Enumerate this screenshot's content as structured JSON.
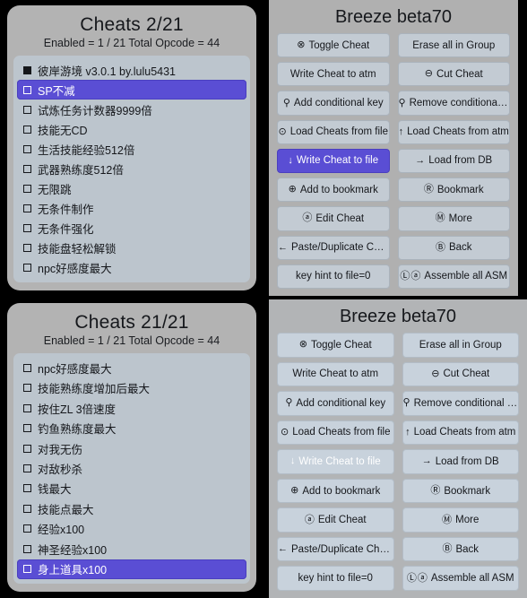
{
  "panels": {
    "cheats_top": {
      "title": "Cheats 2/21",
      "subtitle": "Enabled = 1 / 21  Total Opcode = 44",
      "rows": [
        {
          "label": "彼岸游境 v3.0.1 by.lulu5431",
          "kind": "group",
          "selected": false
        },
        {
          "label": "SP不减",
          "kind": "cheat",
          "selected": true
        },
        {
          "label": "试炼任务计数器9999倍",
          "kind": "cheat",
          "selected": false
        },
        {
          "label": "技能无CD",
          "kind": "cheat",
          "selected": false
        },
        {
          "label": "生活技能经验512倍",
          "kind": "cheat",
          "selected": false
        },
        {
          "label": "武器熟练度512倍",
          "kind": "cheat",
          "selected": false
        },
        {
          "label": "无限跳",
          "kind": "cheat",
          "selected": false
        },
        {
          "label": "无条件制作",
          "kind": "cheat",
          "selected": false
        },
        {
          "label": "无条件强化",
          "kind": "cheat",
          "selected": false
        },
        {
          "label": "技能盘轻松解锁",
          "kind": "cheat",
          "selected": false
        },
        {
          "label": "npc好感度最大",
          "kind": "cheat",
          "selected": false
        }
      ]
    },
    "cheats_bottom": {
      "title": "Cheats 21/21",
      "subtitle": "Enabled = 1 / 21  Total Opcode = 44",
      "rows": [
        {
          "label": "npc好感度最大",
          "kind": "cheat",
          "selected": false
        },
        {
          "label": "技能熟练度增加后最大",
          "kind": "cheat",
          "selected": false
        },
        {
          "label": "按住ZL 3倍速度",
          "kind": "cheat",
          "selected": false
        },
        {
          "label": "钓鱼熟练度最大",
          "kind": "cheat",
          "selected": false
        },
        {
          "label": "对我无伤",
          "kind": "cheat",
          "selected": false
        },
        {
          "label": "对敌秒杀",
          "kind": "cheat",
          "selected": false
        },
        {
          "label": "钱最大",
          "kind": "cheat",
          "selected": false
        },
        {
          "label": "技能点最大",
          "kind": "cheat",
          "selected": false
        },
        {
          "label": "经验x100",
          "kind": "cheat",
          "selected": false
        },
        {
          "label": "神圣经验x100",
          "kind": "cheat",
          "selected": false
        },
        {
          "label": "身上道具x100",
          "kind": "cheat",
          "selected": true
        }
      ]
    },
    "breeze_top": {
      "title": "Breeze beta70",
      "buttons": [
        {
          "label": "Toggle Cheat",
          "icon": "⊗",
          "icon_name": "circle-x-icon",
          "primary": false
        },
        {
          "label": "Erase all in Group",
          "icon": "",
          "icon_name": "",
          "primary": false
        },
        {
          "label": "Write Cheat to atm",
          "icon": "",
          "icon_name": "",
          "primary": false
        },
        {
          "label": "Cut Cheat",
          "icon": "⊖",
          "icon_name": "circle-minus-icon",
          "primary": false
        },
        {
          "label": "Add conditional key",
          "icon": "⚲",
          "icon_name": "key-icon",
          "primary": false
        },
        {
          "label": "Remove conditional key",
          "icon": "⚲",
          "icon_name": "key-icon",
          "primary": false
        },
        {
          "label": "Load Cheats from file",
          "icon": "⊙",
          "icon_name": "circle-dot-icon",
          "primary": false
        },
        {
          "label": "Load Cheats from atm",
          "icon": "↑",
          "icon_name": "arrow-up-icon",
          "primary": false
        },
        {
          "label": "Write Cheat to file",
          "icon": "↓",
          "icon_name": "arrow-down-icon",
          "primary": true
        },
        {
          "label": "Load from DB",
          "icon": "→",
          "icon_name": "arrow-right-icon",
          "primary": false
        },
        {
          "label": "Add to bookmark",
          "icon": "⊕",
          "icon_name": "circle-plus-icon",
          "primary": false
        },
        {
          "label": "Bookmark",
          "icon": "Ⓡ",
          "icon_name": "letter-r-icon",
          "primary": false
        },
        {
          "label": "Edit Cheat",
          "icon": "ⓐ",
          "icon_name": "letter-a-icon",
          "primary": false
        },
        {
          "label": "More",
          "icon": "Ⓜ",
          "icon_name": "letter-m-icon",
          "primary": false
        },
        {
          "label": "Paste/Duplicate Cheat",
          "icon": "←",
          "icon_name": "arrow-left-icon",
          "primary": false
        },
        {
          "label": "Back",
          "icon": "Ⓑ",
          "icon_name": "letter-b-icon",
          "primary": false
        },
        {
          "label": "key hint to file=0",
          "icon": "",
          "icon_name": "",
          "primary": false
        },
        {
          "label": "Assemble all ASM",
          "icon": "Ⓛⓐ",
          "icon_name": "letter-l-a-icon",
          "primary": false
        }
      ]
    },
    "breeze_bottom": {
      "title": "Breeze beta70",
      "buttons": [
        {
          "label": "Toggle Cheat",
          "icon": "⊗",
          "icon_name": "circle-x-icon",
          "primary": false
        },
        {
          "label": "Erase all in Group",
          "icon": "",
          "icon_name": "",
          "primary": false
        },
        {
          "label": "Write Cheat to atm",
          "icon": "",
          "icon_name": "",
          "primary": false
        },
        {
          "label": "Cut Cheat",
          "icon": "⊖",
          "icon_name": "circle-minus-icon",
          "primary": false
        },
        {
          "label": "Add conditional key",
          "icon": "⚲",
          "icon_name": "key-icon",
          "primary": false
        },
        {
          "label": "Remove conditional key",
          "icon": "⚲",
          "icon_name": "key-icon",
          "primary": false
        },
        {
          "label": "Load Cheats from file",
          "icon": "⊙",
          "icon_name": "circle-dot-icon",
          "primary": false
        },
        {
          "label": "Load Cheats from atm",
          "icon": "↑",
          "icon_name": "arrow-up-icon",
          "primary": false
        },
        {
          "label": "Write Cheat to file",
          "icon": "↓",
          "icon_name": "arrow-down-icon",
          "primary": true
        },
        {
          "label": "Load from DB",
          "icon": "→",
          "icon_name": "arrow-right-icon",
          "primary": false
        },
        {
          "label": "Add to bookmark",
          "icon": "⊕",
          "icon_name": "circle-plus-icon",
          "primary": false
        },
        {
          "label": "Bookmark",
          "icon": "Ⓡ",
          "icon_name": "letter-r-icon",
          "primary": false
        },
        {
          "label": "Edit Cheat",
          "icon": "ⓐ",
          "icon_name": "letter-a-icon",
          "primary": false
        },
        {
          "label": "More",
          "icon": "Ⓜ",
          "icon_name": "letter-m-icon",
          "primary": false
        },
        {
          "label": "Paste/Duplicate Cheat",
          "icon": "←",
          "icon_name": "arrow-left-icon",
          "primary": false
        },
        {
          "label": "Back",
          "icon": "Ⓑ",
          "icon_name": "letter-b-icon",
          "primary": false
        },
        {
          "label": "key hint to file=0",
          "icon": "",
          "icon_name": "",
          "primary": false
        },
        {
          "label": "Assemble all ASM",
          "icon": "Ⓛⓐ",
          "icon_name": "letter-l-a-icon",
          "primary": false
        }
      ]
    }
  },
  "colors": {
    "background": "#000000",
    "panel_gray": "#b3b3b3",
    "list_bg": "#bcc5cd",
    "button_bg": "#c3cbd3",
    "accent_purple": "#5a4ed4",
    "text_dark": "#15171b"
  }
}
